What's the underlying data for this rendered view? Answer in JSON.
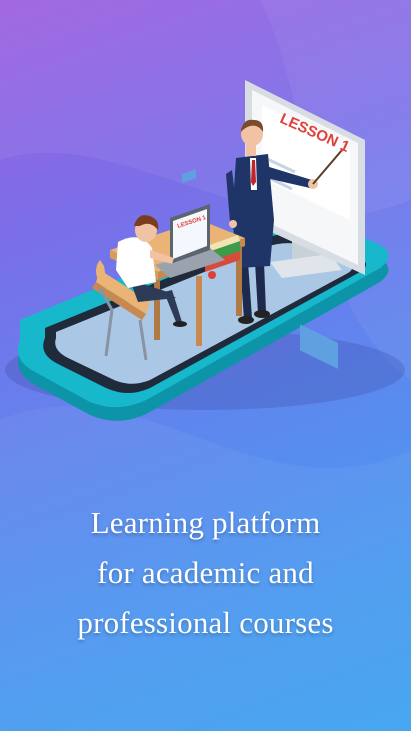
{
  "hero": {
    "monitor_text": "LESSON 1",
    "laptop_text": "LESSON 1"
  },
  "tagline": {
    "line1": "Learning platform",
    "line2": "for academic and",
    "line3": "professional courses"
  },
  "colors": {
    "bg_top": "#9d5fe0",
    "bg_bottom": "#3fa3f0",
    "phone_body": "#17b8cc",
    "accent_red": "#e0403a"
  }
}
